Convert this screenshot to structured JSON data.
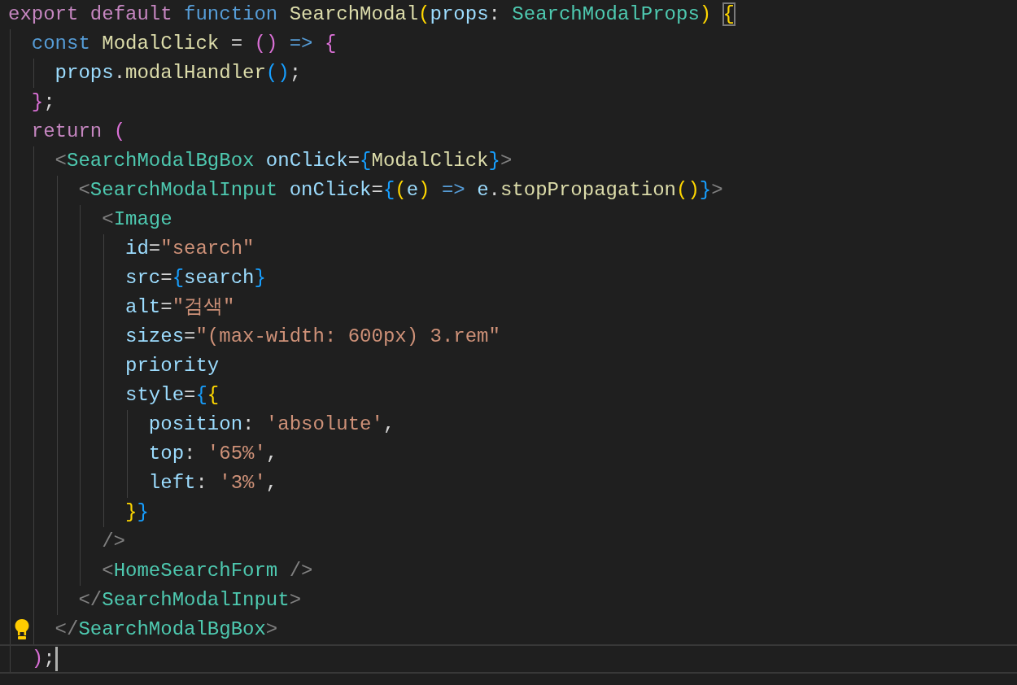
{
  "editor": {
    "lines": [
      {
        "lightbulb": false,
        "current": false,
        "tokens": [
          {
            "text": "export ",
            "kind": "control"
          },
          {
            "text": "default ",
            "kind": "control"
          },
          {
            "text": "function ",
            "kind": "storage"
          },
          {
            "text": "SearchModal",
            "kind": "func"
          },
          {
            "text": "(",
            "kind": "b1"
          },
          {
            "text": "props",
            "kind": "param"
          },
          {
            "text": ": ",
            "kind": "punct"
          },
          {
            "text": "SearchModalProps",
            "kind": "type"
          },
          {
            "text": ") ",
            "kind": "b1"
          },
          {
            "text": "{",
            "kind": "b1match"
          }
        ]
      },
      {
        "lightbulb": false,
        "current": false,
        "tokens": [
          {
            "text": "  const ",
            "kind": "storage"
          },
          {
            "text": "ModalClick",
            "kind": "func"
          },
          {
            "text": " = ",
            "kind": "punct"
          },
          {
            "text": "()",
            "kind": "b2"
          },
          {
            "text": " => ",
            "kind": "storage"
          },
          {
            "text": "{",
            "kind": "b2"
          }
        ]
      },
      {
        "lightbulb": false,
        "current": false,
        "tokens": [
          {
            "text": "    props",
            "kind": "param"
          },
          {
            "text": ".",
            "kind": "punct"
          },
          {
            "text": "modalHandler",
            "kind": "func"
          },
          {
            "text": "()",
            "kind": "b3"
          },
          {
            "text": ";",
            "kind": "punct"
          }
        ]
      },
      {
        "lightbulb": false,
        "current": false,
        "tokens": [
          {
            "text": "  }",
            "kind": "b2"
          },
          {
            "text": ";",
            "kind": "punct"
          }
        ]
      },
      {
        "lightbulb": false,
        "current": false,
        "tokens": [
          {
            "text": "  return ",
            "kind": "control"
          },
          {
            "text": "(",
            "kind": "b2"
          }
        ]
      },
      {
        "lightbulb": false,
        "current": false,
        "tokens": [
          {
            "text": "    <",
            "kind": "tag"
          },
          {
            "text": "SearchModalBgBox",
            "kind": "type"
          },
          {
            "text": " onClick",
            "kind": "param"
          },
          {
            "text": "=",
            "kind": "punct"
          },
          {
            "text": "{",
            "kind": "b3"
          },
          {
            "text": "ModalClick",
            "kind": "func"
          },
          {
            "text": "}",
            "kind": "b3"
          },
          {
            "text": ">",
            "kind": "tag"
          }
        ]
      },
      {
        "lightbulb": false,
        "current": false,
        "tokens": [
          {
            "text": "      <",
            "kind": "tag"
          },
          {
            "text": "SearchModalInput",
            "kind": "type"
          },
          {
            "text": " onClick",
            "kind": "param"
          },
          {
            "text": "=",
            "kind": "punct"
          },
          {
            "text": "{",
            "kind": "b3"
          },
          {
            "text": "(",
            "kind": "b1"
          },
          {
            "text": "e",
            "kind": "param"
          },
          {
            "text": ")",
            "kind": "b1"
          },
          {
            "text": " => ",
            "kind": "storage"
          },
          {
            "text": "e",
            "kind": "param"
          },
          {
            "text": ".",
            "kind": "punct"
          },
          {
            "text": "stopPropagation",
            "kind": "func"
          },
          {
            "text": "()",
            "kind": "b1"
          },
          {
            "text": "}",
            "kind": "b3"
          },
          {
            "text": ">",
            "kind": "tag"
          }
        ]
      },
      {
        "lightbulb": false,
        "current": false,
        "tokens": [
          {
            "text": "        <",
            "kind": "tag"
          },
          {
            "text": "Image",
            "kind": "type"
          }
        ]
      },
      {
        "lightbulb": false,
        "current": false,
        "tokens": [
          {
            "text": "          id",
            "kind": "param"
          },
          {
            "text": "=",
            "kind": "punct"
          },
          {
            "text": "\"search\"",
            "kind": "string"
          }
        ]
      },
      {
        "lightbulb": false,
        "current": false,
        "tokens": [
          {
            "text": "          src",
            "kind": "param"
          },
          {
            "text": "=",
            "kind": "punct"
          },
          {
            "text": "{",
            "kind": "b3"
          },
          {
            "text": "search",
            "kind": "param"
          },
          {
            "text": "}",
            "kind": "b3"
          }
        ]
      },
      {
        "lightbulb": false,
        "current": false,
        "tokens": [
          {
            "text": "          alt",
            "kind": "param"
          },
          {
            "text": "=",
            "kind": "punct"
          },
          {
            "text": "\"검색\"",
            "kind": "string"
          }
        ]
      },
      {
        "lightbulb": false,
        "current": false,
        "tokens": [
          {
            "text": "          sizes",
            "kind": "param"
          },
          {
            "text": "=",
            "kind": "punct"
          },
          {
            "text": "\"(max-width: 600px) 3.rem\"",
            "kind": "string"
          }
        ]
      },
      {
        "lightbulb": false,
        "current": false,
        "tokens": [
          {
            "text": "          priority",
            "kind": "param"
          }
        ]
      },
      {
        "lightbulb": false,
        "current": false,
        "tokens": [
          {
            "text": "          style",
            "kind": "param"
          },
          {
            "text": "=",
            "kind": "punct"
          },
          {
            "text": "{",
            "kind": "b3"
          },
          {
            "text": "{",
            "kind": "b1"
          }
        ]
      },
      {
        "lightbulb": false,
        "current": false,
        "tokens": [
          {
            "text": "            position",
            "kind": "param"
          },
          {
            "text": ": ",
            "kind": "punct"
          },
          {
            "text": "'absolute'",
            "kind": "string"
          },
          {
            "text": ",",
            "kind": "punct"
          }
        ]
      },
      {
        "lightbulb": false,
        "current": false,
        "tokens": [
          {
            "text": "            top",
            "kind": "param"
          },
          {
            "text": ": ",
            "kind": "punct"
          },
          {
            "text": "'65%'",
            "kind": "string"
          },
          {
            "text": ",",
            "kind": "punct"
          }
        ]
      },
      {
        "lightbulb": false,
        "current": false,
        "tokens": [
          {
            "text": "            left",
            "kind": "param"
          },
          {
            "text": ": ",
            "kind": "punct"
          },
          {
            "text": "'3%'",
            "kind": "string"
          },
          {
            "text": ",",
            "kind": "punct"
          }
        ]
      },
      {
        "lightbulb": false,
        "current": false,
        "tokens": [
          {
            "text": "          }",
            "kind": "b1"
          },
          {
            "text": "}",
            "kind": "b3"
          }
        ]
      },
      {
        "lightbulb": false,
        "current": false,
        "tokens": [
          {
            "text": "        />",
            "kind": "tag"
          }
        ]
      },
      {
        "lightbulb": false,
        "current": false,
        "tokens": [
          {
            "text": "        <",
            "kind": "tag"
          },
          {
            "text": "HomeSearchForm",
            "kind": "type"
          },
          {
            "text": " />",
            "kind": "tag"
          }
        ]
      },
      {
        "lightbulb": false,
        "current": false,
        "tokens": [
          {
            "text": "      </",
            "kind": "tag"
          },
          {
            "text": "SearchModalInput",
            "kind": "type"
          },
          {
            "text": ">",
            "kind": "tag"
          }
        ]
      },
      {
        "lightbulb": true,
        "current": false,
        "tokens": [
          {
            "text": "    </",
            "kind": "tag"
          },
          {
            "text": "SearchModalBgBox",
            "kind": "type"
          },
          {
            "text": ">",
            "kind": "tag"
          }
        ]
      },
      {
        "lightbulb": false,
        "current": true,
        "tokens": [
          {
            "text": "  )",
            "kind": "b2"
          },
          {
            "text": ";",
            "kind": "punct"
          }
        ]
      }
    ]
  }
}
